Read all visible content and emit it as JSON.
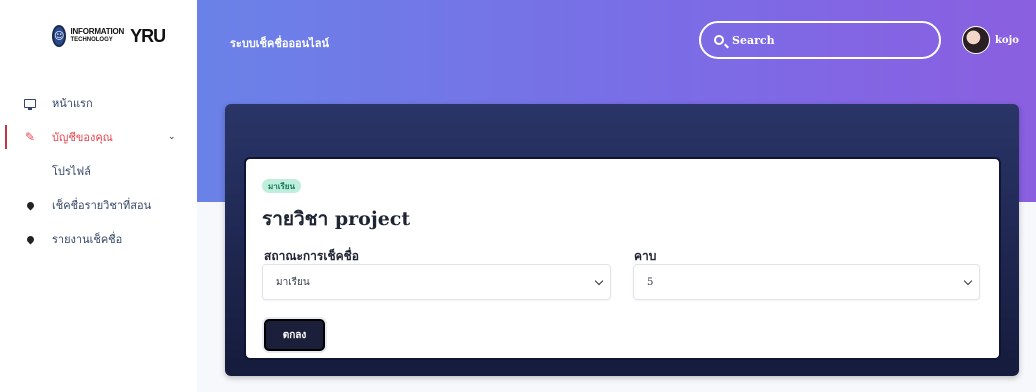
{
  "logo": {
    "line1": "INFORMATION",
    "line2": "TECHNOLOGY",
    "mark": "YRU"
  },
  "sidebar": {
    "items": [
      {
        "label": "หน้าแรก",
        "icon": "monitor-icon"
      },
      {
        "label": "บัญชีของคุณ",
        "icon": "user-card-icon",
        "active": true,
        "expanded": true
      },
      {
        "label": "โปรไฟล์",
        "icon": null
      },
      {
        "label": "เช็คชื่อรายวิชาที่สอน",
        "icon": "pin-icon"
      },
      {
        "label": "รายงานเช็คชื่อ",
        "icon": "pin-icon"
      }
    ]
  },
  "header": {
    "title": "ระบบเช็คชื่อออนไลน์",
    "search_placeholder": "Search",
    "user_name": "kojo"
  },
  "card": {
    "status_badge": "มาเรียน",
    "course_title": "รายวิชา project",
    "status_label": "สถาณะการเช็คชื่อ",
    "status_value": "มาเรียน",
    "period_label": "คาบ",
    "period_value": "5",
    "submit_label": "ตกลง"
  },
  "colors": {
    "accent_active": "#e64550",
    "gradient_start": "#6a82e8",
    "gradient_end": "#8a5fe0",
    "card_dark": "#1b2350",
    "badge_bg": "#bfeedd"
  }
}
